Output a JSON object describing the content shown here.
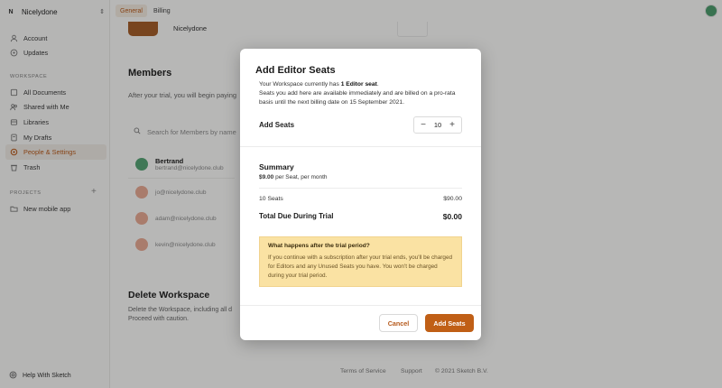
{
  "sidebar": {
    "workspace_badge": "N",
    "workspace_name": "Nicelydone",
    "account": "Account",
    "updates": "Updates",
    "workspace_section": "WORKSPACE",
    "items": [
      {
        "label": "All Documents",
        "icon": "documents-icon"
      },
      {
        "label": "Shared with Me",
        "icon": "shared-icon"
      },
      {
        "label": "Libraries",
        "icon": "libraries-icon"
      },
      {
        "label": "My Drafts",
        "icon": "drafts-icon"
      },
      {
        "label": "People & Settings",
        "icon": "settings-icon"
      },
      {
        "label": "Trash",
        "icon": "trash-icon"
      }
    ],
    "projects_section": "PROJECTS",
    "project": "New mobile app",
    "help": "Help With Sketch"
  },
  "tabs": {
    "general": "General",
    "billing": "Billing"
  },
  "main": {
    "workspace_title": "Nicelydone",
    "members_heading": "Members",
    "members_text": "After your trial, you will begin paying",
    "search_placeholder": "Search for Members by name",
    "members": [
      {
        "name": "Bertrand",
        "email": "bertrand@nicelydone.club"
      },
      {
        "name": "",
        "email": "jo@nicelydone.club"
      },
      {
        "name": "",
        "email": "adam@nicelydone.club"
      },
      {
        "name": "",
        "email": "kevin@nicelydone.club"
      }
    ],
    "delete_heading": "Delete Workspace",
    "delete_text": "Delete the Workspace, including all d Proceed with caution.",
    "footer_terms": "Terms of Service",
    "footer_support": "Support",
    "footer_copyright": "© 2021 Sketch B.V."
  },
  "modal": {
    "title": "Add Editor Seats",
    "desc_pre": "Your Workspace currently has ",
    "desc_bold": "1 Editor seat",
    "desc_post": ".",
    "desc_line2": "Seats you add here are available immediately and are billed on a pro-rata basis until the next billing date on 15 September 2021.",
    "add_seats_label": "Add Seats",
    "seat_count": "10",
    "summary_title": "Summary",
    "price_bold": "$9.00",
    "price_suffix": " per Seat, per month",
    "seats_line_label": "10 Seats",
    "seats_line_value": "$90.00",
    "total_label": "Total Due During Trial",
    "total_value": "$0.00",
    "notice_title": "What happens after the trial period?",
    "notice_body": "If you continue with a subscription after your trial ends, you'll be charged for Editors and any Unused Seats you have. You won't be charged during your trial period.",
    "cancel": "Cancel",
    "confirm": "Add Seats"
  },
  "colors": {
    "accent": "#c05f16",
    "notice_bg": "#fae2a3"
  }
}
